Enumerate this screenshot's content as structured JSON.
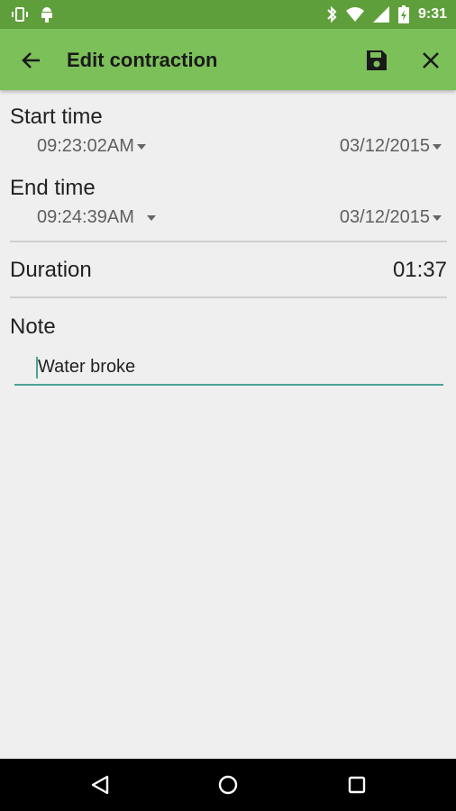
{
  "status_bar": {
    "time": "9:31",
    "icons": [
      "vibrate-icon",
      "android-icon",
      "bluetooth-icon",
      "wifi-icon",
      "signal-icon",
      "battery-icon"
    ]
  },
  "app_bar": {
    "title": "Edit contraction",
    "icons": [
      "back-arrow-icon",
      "save-icon",
      "close-icon"
    ]
  },
  "form": {
    "start": {
      "label": "Start time",
      "time": "09:23:02AM",
      "date": "03/12/2015"
    },
    "end": {
      "label": "End time",
      "time": "09:24:39AM",
      "date": "03/12/2015"
    },
    "duration": {
      "label": "Duration",
      "value": "01:37"
    },
    "note": {
      "label": "Note",
      "value": "Water broke"
    }
  },
  "nav_bar": {
    "icons": [
      "nav-back-icon",
      "nav-home-icon",
      "nav-recents-icon"
    ]
  },
  "colors": {
    "status_bar": "#5f9f3b",
    "app_bar": "#7cc05a",
    "background": "#efefef",
    "accent": "#4aa39a"
  }
}
